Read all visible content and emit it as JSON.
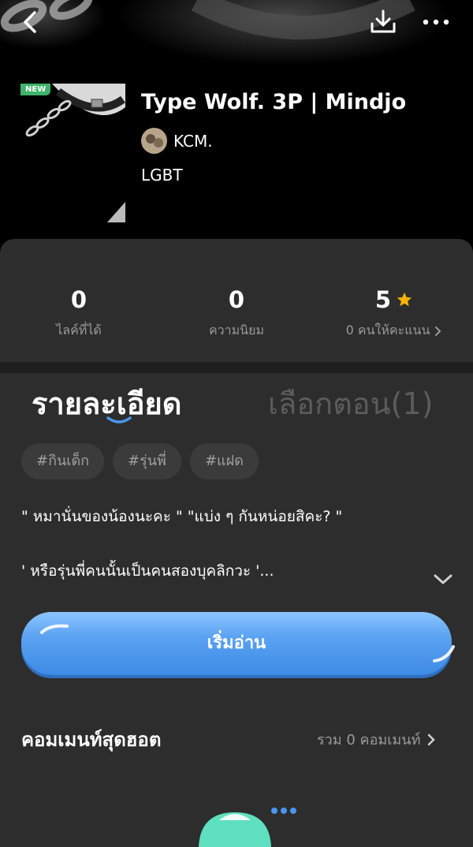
{
  "header": {
    "back_icon": "chevron-left-icon",
    "download_icon": "download-icon",
    "more_icon": "more-horizontal-icon"
  },
  "book": {
    "badge": "NEW",
    "title": "Type Wolf. 3P | Mindjo",
    "author": "KCM.",
    "genre": "LGBT"
  },
  "stats": [
    {
      "value": "0",
      "label": "ไลค์ที่ได้"
    },
    {
      "value": "0",
      "label": "ความนิยม"
    },
    {
      "value": "5",
      "label": "0 คนให้คะแนน"
    }
  ],
  "colors": {
    "star": "#f5b400",
    "accent_blue": "#4a96ee",
    "mascot_teal": "#5ee0c0"
  },
  "tabs": {
    "details": "รายละเอียด",
    "episodes": "เลือกตอน(1)"
  },
  "tags": [
    "#กินเด็ก",
    "#รุ่นพี่",
    "#แฝด"
  ],
  "description": {
    "line1": "\" หมานั่นของน้องนะคะ \" \"แบ่ง ๆ กันหน่อยสิคะ? \"",
    "line2": "' หรือรุ่นพี่คนนั้นเป็นคนสองบุคลิกวะ '..."
  },
  "start_button": "เริ่มอ่าน",
  "comments": {
    "title": "คอมเมนท์สุดฮอต",
    "count": "รวม 0 คอมเมนท์"
  }
}
